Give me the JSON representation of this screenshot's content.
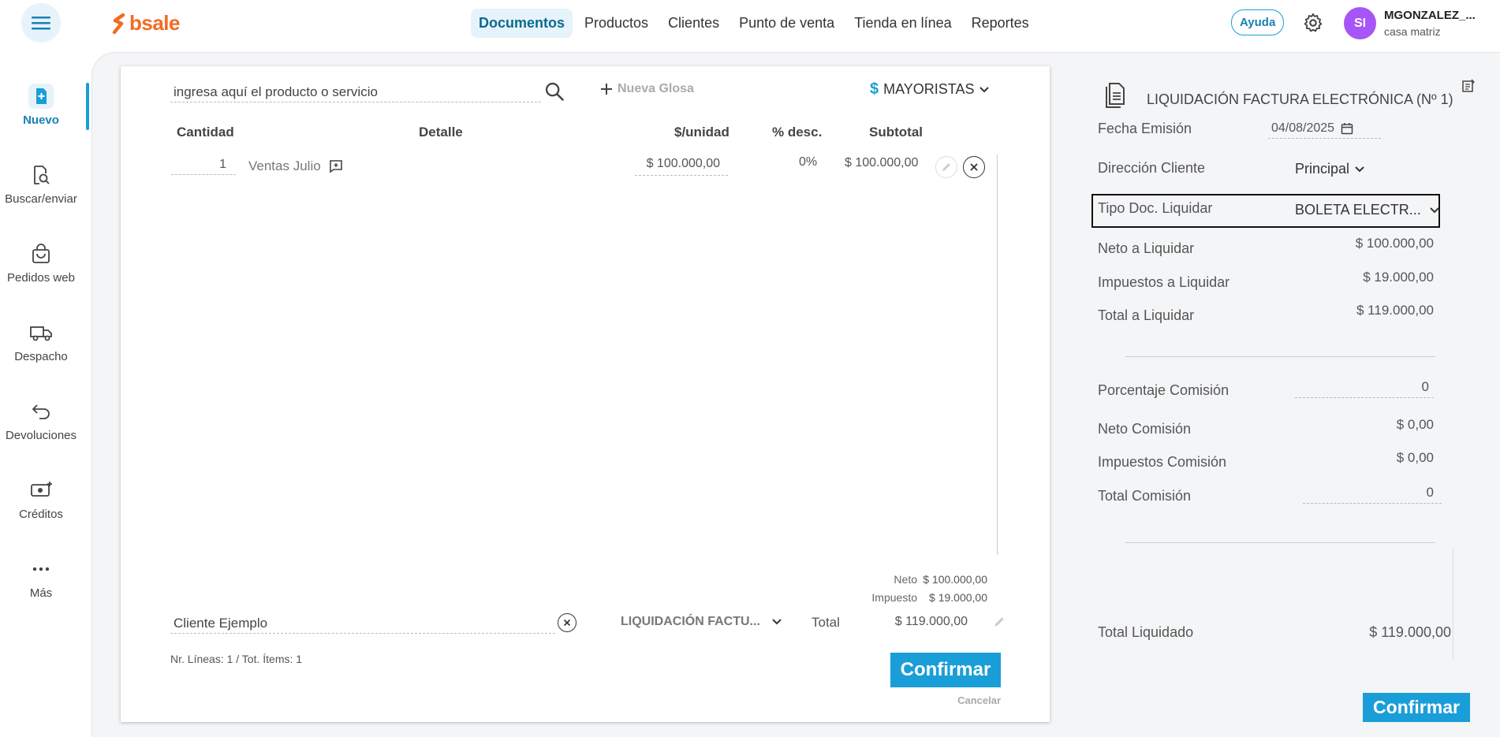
{
  "colors": {
    "accent": "#1a9ed8",
    "brand": "#f26b21",
    "avatar": "#a855f7"
  },
  "brand": {
    "name": "bsale"
  },
  "nav": {
    "items": [
      {
        "label": "Documentos"
      },
      {
        "label": "Productos"
      },
      {
        "label": "Clientes"
      },
      {
        "label": "Punto de venta"
      },
      {
        "label": "Tienda en línea"
      },
      {
        "label": "Reportes"
      }
    ]
  },
  "header": {
    "help_label": "Ayuda",
    "avatar_initials": "SI",
    "user_name": "MGONZALEZ_...",
    "branch": "casa matriz"
  },
  "sidebar": {
    "items": [
      {
        "label": "Nuevo",
        "icon": "new-document-icon"
      },
      {
        "label": "Buscar/enviar",
        "icon": "document-search-icon"
      },
      {
        "label": "Pedidos web",
        "icon": "shopping-bag-icon"
      },
      {
        "label": "Despacho",
        "icon": "truck-icon"
      },
      {
        "label": "Devoluciones",
        "icon": "return-arrow-icon"
      },
      {
        "label": "Créditos",
        "icon": "credit-money-icon"
      },
      {
        "label": "Más",
        "icon": "more-dots-icon"
      }
    ]
  },
  "editor": {
    "product_search_placeholder": "ingresa aquí el producto o servicio",
    "new_gloss_label": "Nueva Glosa",
    "price_list_symbol": "$",
    "price_list": "MAYORISTAS",
    "columns": {
      "quantity": "Cantidad",
      "detail": "Detalle",
      "unit_price": "$/unidad",
      "discount": "% desc.",
      "subtotal": "Subtotal"
    },
    "lines": [
      {
        "quantity": "1",
        "detail": "Ventas Julio",
        "unit_price": "$ 100.000,00",
        "discount": "0%",
        "subtotal": "$ 100.000,00"
      }
    ],
    "totals": {
      "neto_label": "Neto",
      "neto_value": "$ 100.000,00",
      "tax_label": "Impuesto",
      "tax_value": "$ 19.000,00",
      "total_label": "Total",
      "total_value": "$ 119.000,00"
    },
    "client": "Cliente Ejemplo",
    "doc_type": "LIQUIDACIÓN FACTU...",
    "lines_info": "Nr. Líneas: 1 / Tot. Ítems: 1",
    "confirm_label": "Confirmar",
    "cancel_label": "Cancelar"
  },
  "summary": {
    "title": "LIQUIDACIÓN FACTURA ELECTRÓNICA (Nº 1)",
    "fecha_label": "Fecha Emisión",
    "fecha_value": "04/08/2025",
    "direccion_label": "Dirección Cliente",
    "direccion_value": "Principal",
    "tipo_doc_label": "Tipo Doc. Liquidar",
    "tipo_doc_value": "BOLETA ELECTR...",
    "neto_label": "Neto a Liquidar",
    "neto_value": "$ 100.000,00",
    "impuestos_label": "Impuestos a Liquidar",
    "impuestos_value": "$ 19.000,00",
    "total_label": "Total a Liquidar",
    "total_value": "$ 119.000,00",
    "porcentaje_label": "Porcentaje Comisión",
    "porcentaje_value": "0",
    "neto_comision_label": "Neto Comisión",
    "neto_comision_value": "$ 0,00",
    "impuestos_comision_label": "Impuestos Comisión",
    "impuestos_comision_value": "$ 0,00",
    "total_comision_label": "Total Comisión",
    "total_comision_value": "0",
    "total_liquidado_label": "Total Liquidado",
    "total_liquidado_value": "$ 119.000,00",
    "confirm_label": "Confirmar"
  }
}
